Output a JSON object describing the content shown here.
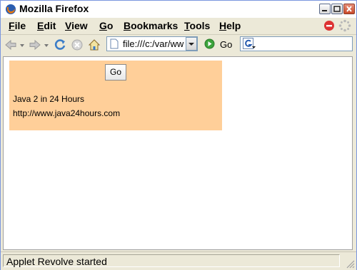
{
  "window": {
    "title": "Mozilla Firefox"
  },
  "menu": {
    "items": [
      {
        "first": "F",
        "rest": "ile"
      },
      {
        "first": "E",
        "rest": "dit"
      },
      {
        "first": "V",
        "rest": "iew"
      },
      {
        "first": "G",
        "rest": "o"
      },
      {
        "first": "B",
        "rest": "ookmarks"
      },
      {
        "first": "T",
        "rest": "ools"
      },
      {
        "first": "H",
        "rest": "elp"
      }
    ]
  },
  "toolbar": {
    "url_value": "file:///c:/var/ww",
    "go_label": "Go"
  },
  "applet": {
    "button_label": "Go",
    "line1": "Java 2 in 24 Hours",
    "line2": "http://www.java24hours.com"
  },
  "status": {
    "text": "Applet Revolve started"
  },
  "colors": {
    "applet_background": "#ffcf99",
    "chrome": "#ece9d8"
  }
}
